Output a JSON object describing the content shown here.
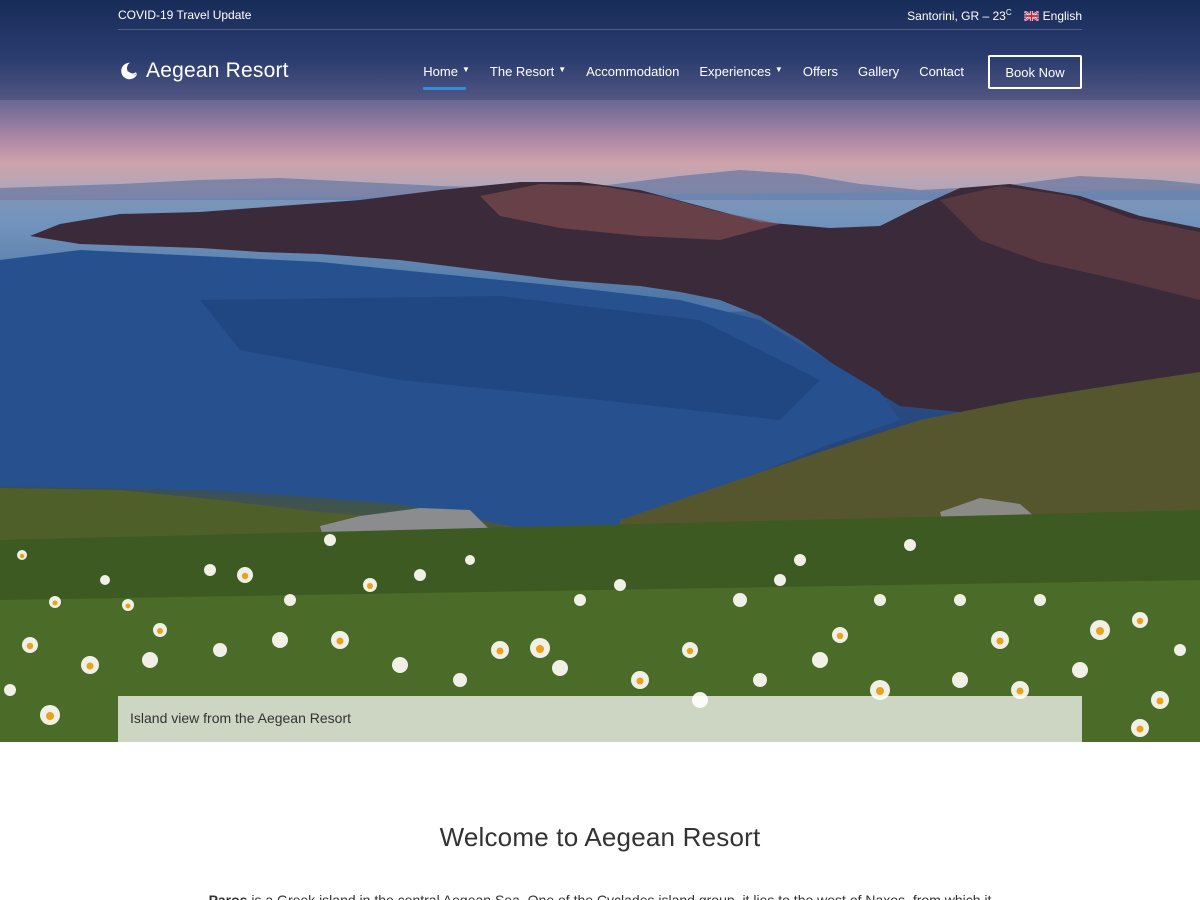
{
  "topbar": {
    "covid_link": "COVID-19 Travel Update",
    "weather_location": "Santorini, GR – 23",
    "weather_unit": "C",
    "language": "English"
  },
  "brand": {
    "name": "Aegean Resort"
  },
  "nav": {
    "items": [
      {
        "label": "Home",
        "has_dropdown": true,
        "active": true
      },
      {
        "label": "The Resort",
        "has_dropdown": true
      },
      {
        "label": "Accommodation",
        "has_dropdown": false
      },
      {
        "label": "Experiences",
        "has_dropdown": true
      },
      {
        "label": "Offers",
        "has_dropdown": false
      },
      {
        "label": "Gallery",
        "has_dropdown": false
      },
      {
        "label": "Contact",
        "has_dropdown": false
      }
    ],
    "book_label": "Book Now"
  },
  "hero": {
    "caption": "Island view from the Aegean Resort"
  },
  "welcome": {
    "title": "Welcome to Aegean Resort",
    "intro_bold": "Paros",
    "intro_text": " is a Greek island in the central Aegean Sea. One of the Cyclades island group, it lies to the west of Naxos, from which it"
  },
  "colors": {
    "accent": "#2f8fd6",
    "text": "#333333"
  }
}
